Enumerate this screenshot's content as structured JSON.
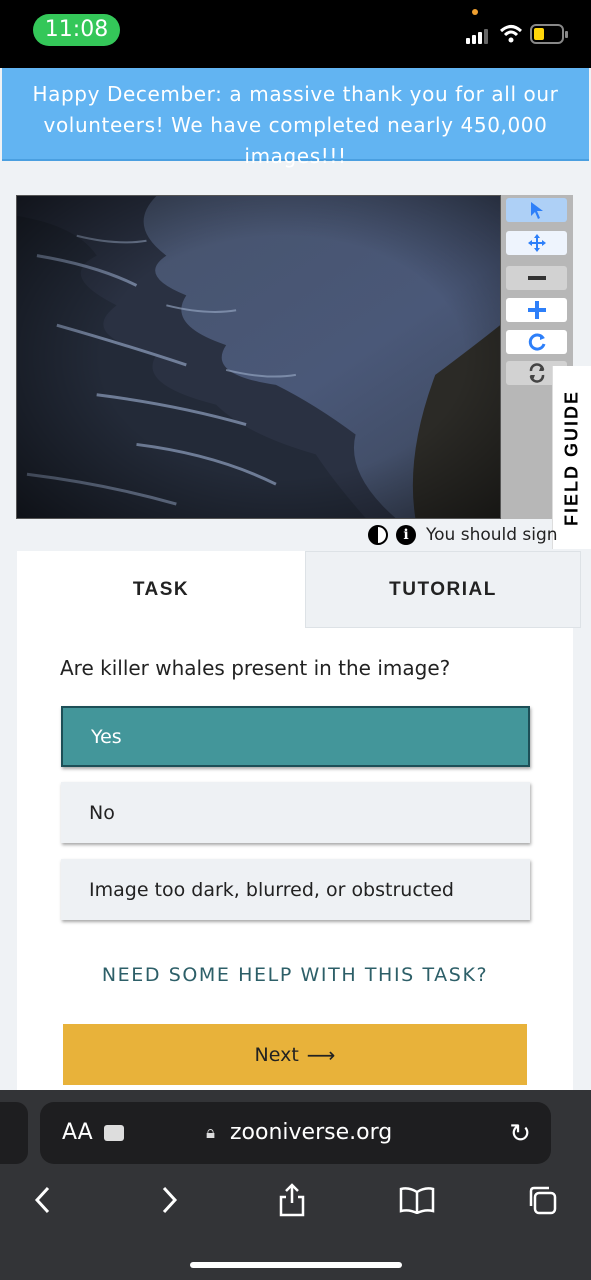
{
  "status": {
    "time": "11:08"
  },
  "banner": {
    "text": "Happy December: a massive thank you for all our volunteers! We have completed nearly 450,000 images!!!"
  },
  "viewer": {
    "tools": [
      "pointer-icon",
      "move-icon",
      "zoom-out-icon",
      "zoom-in-icon",
      "rotate-icon",
      "reset-icon"
    ],
    "field_guide": "FIELD GUIDE",
    "meta_text": "You should sign"
  },
  "tabs": {
    "task": "TASK",
    "tutorial": "TUTORIAL"
  },
  "task": {
    "question": "Are killer whales present in the image?",
    "answers": [
      "Yes",
      "No",
      "Image too dark, blurred, or obstructed"
    ],
    "selected": 0,
    "help": "NEED SOME HELP WITH THIS TASK?",
    "next": "Next"
  },
  "browser": {
    "text_size": "AA",
    "url": "zooniverse.org"
  },
  "colors": {
    "banner": "#62b4f2",
    "selected_answer": "#43969a",
    "next_button": "#e8b23a",
    "tool_icon": "#2d7ff9"
  }
}
